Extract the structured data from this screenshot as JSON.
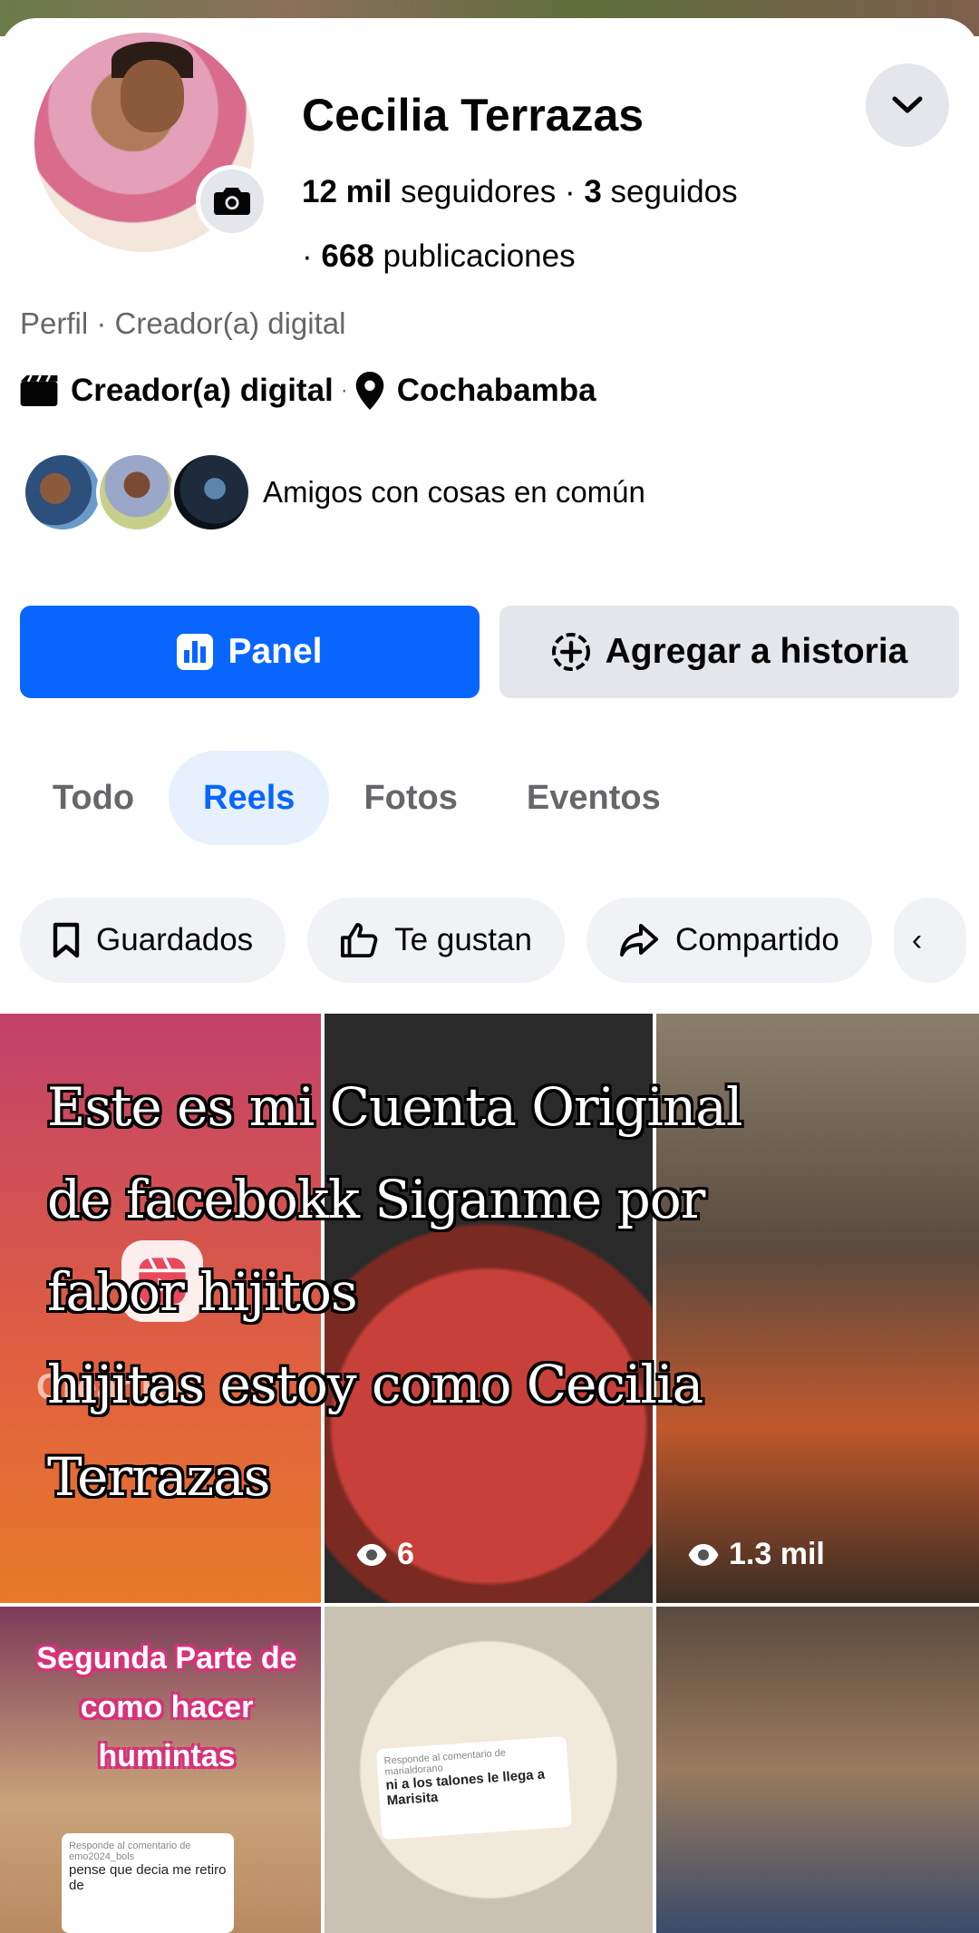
{
  "profile": {
    "name": "Cecilia Terrazas",
    "followers_count": "12 mil",
    "followers_label": "seguidores",
    "following_count": "3",
    "following_label": "seguidos",
    "posts_count": "668",
    "posts_label": "publicaciones",
    "subtitle": "Perfil · Creador(a) digital",
    "category": "Creador(a) digital",
    "location": "Cochabamba",
    "mutual_text": "Amigos con cosas en común"
  },
  "actions": {
    "panel_label": "Panel",
    "story_label": "Agregar a historia"
  },
  "tabs": [
    {
      "label": "Todo",
      "active": false
    },
    {
      "label": "Reels",
      "active": true
    },
    {
      "label": "Fotos",
      "active": false
    },
    {
      "label": "Eventos",
      "active": false
    }
  ],
  "chips": [
    {
      "label": "Guardados",
      "icon": "bookmark-icon"
    },
    {
      "label": "Te gustan",
      "icon": "thumbs-up-icon"
    },
    {
      "label": "Compartido",
      "icon": "share-icon"
    }
  ],
  "reels": {
    "create_label": "Crear reel",
    "tile2_views": "6",
    "tile3_views": "1.3 mil",
    "tile4_caption": "Segunda Parte de como hacer humintas",
    "tile4_note_header": "Responde al comentario de",
    "tile4_note_user": "emo2024_bols",
    "tile4_note_text": "pense que decia me retiro de",
    "tile5_note_header": "Responde al comentario de",
    "tile5_note_user": "marialdorano",
    "tile5_note_text": "ni a los talones le llega a Marisita"
  },
  "overlay_text": [
    "Este es  mi Cuenta Original",
    "de facebokk  Siganme por",
    "fabor hijitos",
    "hijitas estoy como Cecilia",
    "Terrazas"
  ],
  "colors": {
    "primary": "#0866ff",
    "secondary_bg": "#e4e6eb",
    "active_tab_bg": "#e7f0fd",
    "muted_text": "#65676b"
  }
}
